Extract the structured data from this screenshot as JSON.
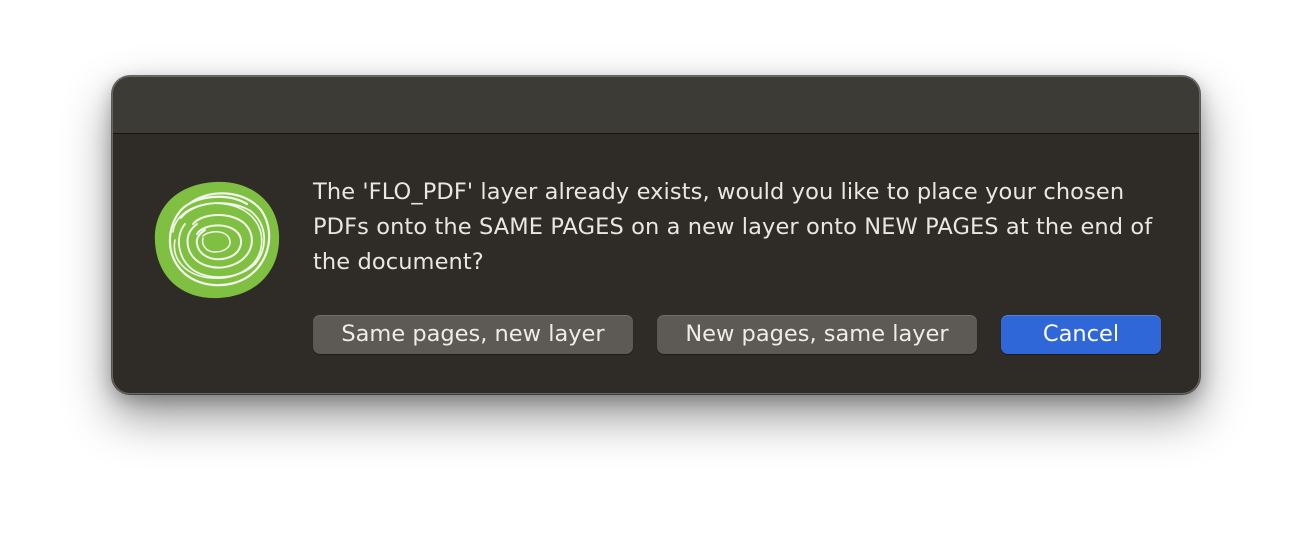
{
  "dialog": {
    "message": "The 'FLO_PDF' layer already exists, would you like to place your chosen PDFs onto the SAME PAGES on a new layer onto NEW PAGES at the end of the document?",
    "icon": "green-spiral-app-icon",
    "buttons": {
      "same_pages_new_layer": "Same pages, new layer",
      "new_pages_same_layer": "New pages, same layer",
      "cancel": "Cancel"
    }
  },
  "colors": {
    "dialog_background": "#2f2c27",
    "titlebar": "#3d3b36",
    "secondary_button": "#5d5a55",
    "primary_button": "#2f67d8",
    "icon_green": "#7fc043"
  }
}
